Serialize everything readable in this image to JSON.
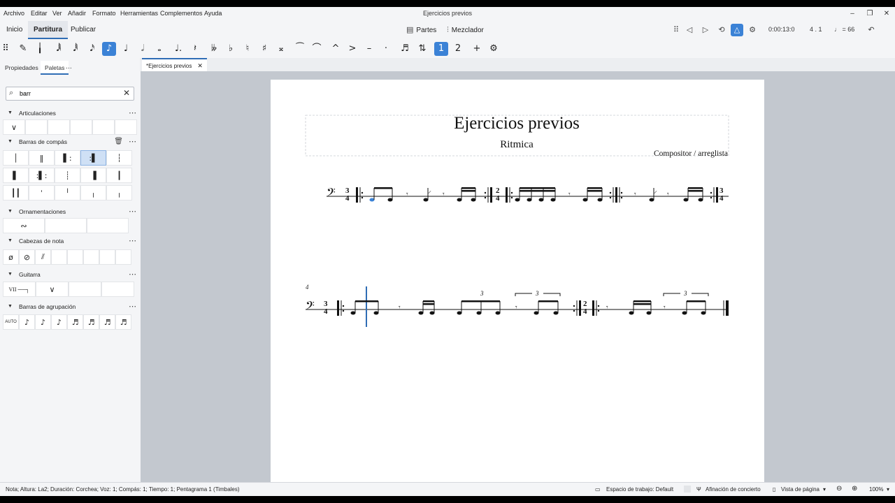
{
  "window": {
    "title": "Ejercicios previos"
  },
  "menu": [
    "Archivo",
    "Editar",
    "Ver",
    "Añadir",
    "Formato",
    "Herramientas",
    "Complementos",
    "Ayuda"
  ],
  "mode_tabs": [
    "Inicio",
    "Partitura",
    "Publicar"
  ],
  "top_links": {
    "parts": "Partes",
    "mixer": "Mezclador"
  },
  "playback": {
    "time": "0:00:13:0",
    "position": "4 . 1",
    "tempo": "♩ = 66"
  },
  "panel_tabs": {
    "properties": "Propiedades",
    "palettes": "Paletas"
  },
  "search": {
    "value": "barr",
    "placeholder": ""
  },
  "palette_sections": [
    {
      "label": "Articulaciones"
    },
    {
      "label": "Barras de compás"
    },
    {
      "label": "Ornamentaciones"
    },
    {
      "label": "Cabezas de nota"
    },
    {
      "label": "Guitarra"
    },
    {
      "label": "Barras de agrupación"
    }
  ],
  "palette_cells": {
    "guitar_barre": "VII",
    "auto_beam": "AUTO"
  },
  "document_tab": "*Ejercicios previos",
  "score": {
    "title": "Ejercicios previos",
    "subtitle": "Ritmica",
    "composer": "Compositor / arreglista",
    "measure_number": "4",
    "time_sig_1": [
      "3",
      "4"
    ],
    "time_sig_2": [
      "2",
      "4"
    ],
    "tuplet": "3"
  },
  "status": {
    "selection": "Nota; Altura: La2; Duración: Corchea; Voz: 1; Compás: 1; Tiempo: 1; Pentagrama 1 (Timbales)",
    "workspace": "Espacio de trabajo: Default",
    "concert_pitch": "Afinación de concierto",
    "view": "Vista de página",
    "zoom": "100%"
  },
  "colors": {
    "accent": "#3b82d6",
    "selected_note": "#3b82d6",
    "canvas": "#c3c8cf"
  }
}
